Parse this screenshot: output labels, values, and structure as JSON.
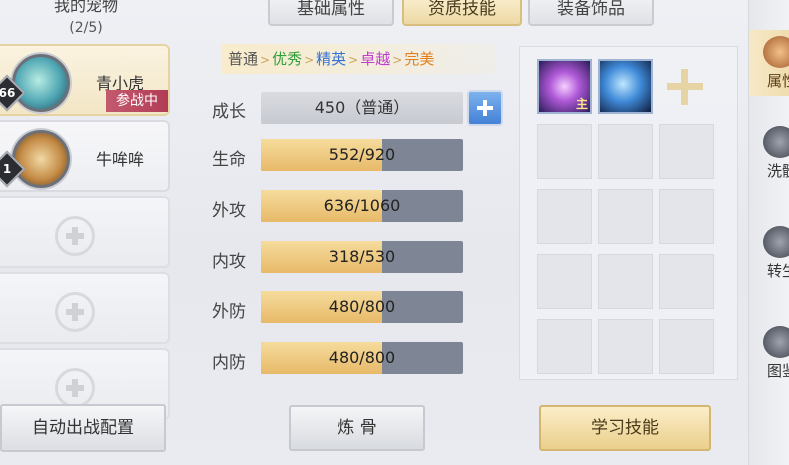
{
  "pets": {
    "title": "我的宠物",
    "count": "(2/5)",
    "items": [
      {
        "name": "青小虎",
        "level": "66",
        "badge": "参战中"
      },
      {
        "name": "牛哞哞",
        "level": "1",
        "badge": ""
      }
    ],
    "auto_button": "自动出战配置"
  },
  "tabs": [
    {
      "label": "基础属性",
      "active": false
    },
    {
      "label": "资质技能",
      "active": true
    },
    {
      "label": "装备饰品",
      "active": false
    }
  ],
  "quality": {
    "levels": [
      {
        "label": "普通",
        "color": "#555555"
      },
      {
        "label": "优秀",
        "color": "#2e9e3a"
      },
      {
        "label": "精英",
        "color": "#3473d1"
      },
      {
        "label": "卓越",
        "color": "#c03fcf"
      },
      {
        "label": "完美",
        "color": "#e2801c"
      }
    ],
    "separator": ">"
  },
  "growth": {
    "label": "成长",
    "value": "450（普通）"
  },
  "stats": [
    {
      "label": "生命",
      "text": "552/920",
      "current": 552,
      "max": 920
    },
    {
      "label": "外攻",
      "text": "636/1060",
      "current": 636,
      "max": 1060
    },
    {
      "label": "内攻",
      "text": "318/530",
      "current": 318,
      "max": 530
    },
    {
      "label": "外防",
      "text": "480/800",
      "current": 480,
      "max": 800
    },
    {
      "label": "内防",
      "text": "480/800",
      "current": 480,
      "max": 800
    }
  ],
  "skills": {
    "main_tag": "主",
    "icons": [
      "skill-purple-vortex",
      "skill-blue-spirit"
    ]
  },
  "buttons": {
    "refine": "炼 骨",
    "learn": "学习技能"
  },
  "right_menu": [
    {
      "label": "属性",
      "active": true
    },
    {
      "label": "洗髓",
      "active": false
    },
    {
      "label": "转生",
      "active": false
    },
    {
      "label": "图鉴",
      "active": false
    }
  ]
}
